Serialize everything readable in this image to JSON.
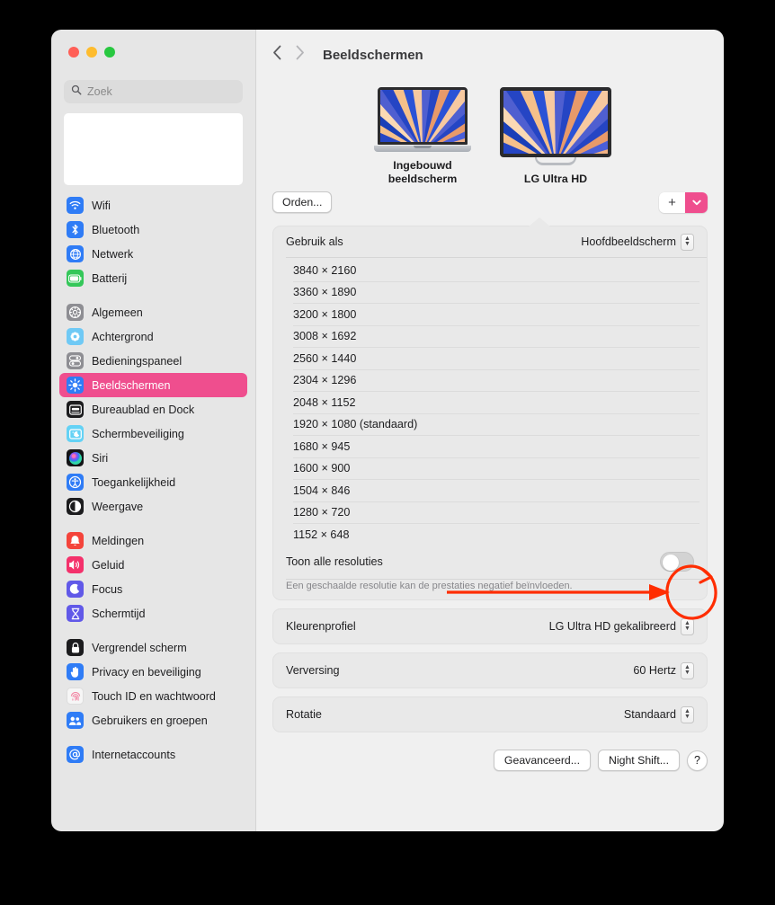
{
  "window": {
    "traffic_lights": [
      "close",
      "minimize",
      "zoom"
    ],
    "colors": {
      "close": "#ff5f57",
      "minimize": "#febc2e",
      "zoom": "#28c840",
      "accent": "#ef4e8e",
      "annotation": "#ff2d00"
    }
  },
  "search": {
    "placeholder": "Zoek",
    "value": "",
    "icon": "search-icon"
  },
  "sidebar": {
    "groups": [
      {
        "items": [
          {
            "label": "Wifi",
            "icon": "wifi-icon",
            "color": "#2f7cf6"
          },
          {
            "label": "Bluetooth",
            "icon": "bluetooth-icon",
            "color": "#2f7cf6"
          },
          {
            "label": "Netwerk",
            "icon": "globe-icon",
            "color": "#2f7cf6"
          },
          {
            "label": "Batterij",
            "icon": "battery-icon",
            "color": "#34c759"
          }
        ]
      },
      {
        "items": [
          {
            "label": "Algemeen",
            "icon": "gear-icon",
            "color": "#8e8e93"
          },
          {
            "label": "Achtergrond",
            "icon": "wallpaper-icon",
            "color": "#6fc9f5"
          },
          {
            "label": "Bedieningspaneel",
            "icon": "control-center-icon",
            "color": "#8e8e93"
          },
          {
            "label": "Beeldschermen",
            "icon": "brightness-icon",
            "color": "#2f7cf6",
            "selected": true
          },
          {
            "label": "Bureaublad en Dock",
            "icon": "dock-icon",
            "color": "#1c1c1e"
          },
          {
            "label": "Schermbeveiliging",
            "icon": "screensaver-icon",
            "color": "#64d2f5"
          },
          {
            "label": "Siri",
            "icon": "siri-icon",
            "color": "#1c1c1e"
          },
          {
            "label": "Toegankelijkheid",
            "icon": "accessibility-icon",
            "color": "#2f7cf6"
          },
          {
            "label": "Weergave",
            "icon": "appearance-icon",
            "color": "#1c1c1e"
          }
        ]
      },
      {
        "items": [
          {
            "label": "Meldingen",
            "icon": "bell-icon",
            "color": "#f4443b"
          },
          {
            "label": "Geluid",
            "icon": "speaker-icon",
            "color": "#f4316b"
          },
          {
            "label": "Focus",
            "icon": "moon-icon",
            "color": "#6159e8"
          },
          {
            "label": "Schermtijd",
            "icon": "hourglass-icon",
            "color": "#6159e8"
          }
        ]
      },
      {
        "items": [
          {
            "label": "Vergrendel scherm",
            "icon": "lock-icon",
            "color": "#1c1c1e"
          },
          {
            "label": "Privacy en beveiliging",
            "icon": "hand-icon",
            "color": "#2f7cf6"
          },
          {
            "label": "Touch ID en wachtwoord",
            "icon": "fingerprint-icon",
            "color": "#f6f6f6"
          },
          {
            "label": "Gebruikers en groepen",
            "icon": "users-icon",
            "color": "#2f7cf6"
          }
        ]
      },
      {
        "items": [
          {
            "label": "Internetaccounts",
            "icon": "at-icon",
            "color": "#2f7cf6"
          }
        ]
      }
    ]
  },
  "header": {
    "back_icon": "chevron-left-icon",
    "forward_icon": "chevron-right-icon",
    "title": "Beeldschermen"
  },
  "displays": {
    "arrange_button": "Orden...",
    "add_button": "+",
    "add_menu_icon": "chevron-down-icon",
    "items": [
      {
        "name": "Ingebouwd beeldscherm",
        "type": "laptop",
        "selected": false
      },
      {
        "name": "LG Ultra HD",
        "type": "monitor",
        "selected": true
      }
    ]
  },
  "use_as": {
    "label": "Gebruik als",
    "value": "Hoofdbeeldscherm"
  },
  "resolutions": [
    "3840 × 2160",
    "3360 × 1890",
    "3200 × 1800",
    "3008 × 1692",
    "2560 × 1440",
    "2304 × 1296",
    "2048 × 1152",
    "1920 × 1080 (standaard)",
    "1680 × 945",
    "1600 × 900",
    "1504 × 846",
    "1280 × 720",
    "1152 × 648"
  ],
  "show_all": {
    "label": "Toon alle resoluties",
    "state": "off"
  },
  "hint": "Een geschaalde resolutie kan de prestaties negatief beïnvloeden.",
  "settings_rows": [
    {
      "label": "Kleurenprofiel",
      "value": "LG Ultra HD gekalibreerd"
    },
    {
      "label": "Verversing",
      "value": "60 Hertz"
    },
    {
      "label": "Rotatie",
      "value": "Standaard"
    }
  ],
  "footer": {
    "advanced": "Geavanceerd...",
    "night_shift": "Night Shift...",
    "help": "?"
  }
}
